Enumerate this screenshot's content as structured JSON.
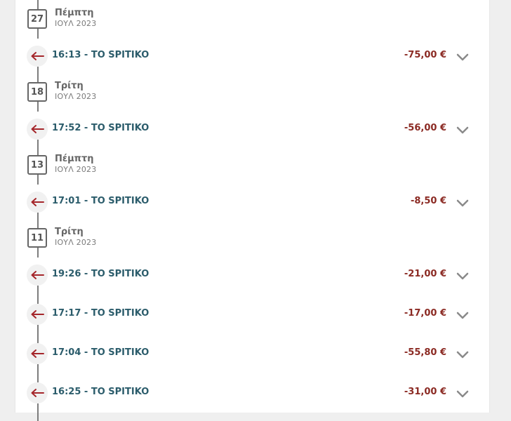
{
  "colors": {
    "accent_text": "#2b5c6b",
    "amount_negative": "#8b2a23",
    "arrow": "#a5262b"
  },
  "icons": {
    "transaction": "arrow-left-icon",
    "expand": "chevron-down-icon"
  },
  "groups": [
    {
      "day_num": "27",
      "day_name": "Πέμπτη",
      "month_year": "ΙΟΥΛ 2023",
      "transactions": [
        {
          "time_merchant": "16:13 - TO SPITIKO",
          "amount": "-75,00 €"
        }
      ]
    },
    {
      "day_num": "18",
      "day_name": "Τρίτη",
      "month_year": "ΙΟΥΛ 2023",
      "transactions": [
        {
          "time_merchant": "17:52 - TO SPITIKO",
          "amount": "-56,00 €"
        }
      ]
    },
    {
      "day_num": "13",
      "day_name": "Πέμπτη",
      "month_year": "ΙΟΥΛ 2023",
      "transactions": [
        {
          "time_merchant": "17:01 - TO SPITIKO",
          "amount": "-8,50 €"
        }
      ]
    },
    {
      "day_num": "11",
      "day_name": "Τρίτη",
      "month_year": "ΙΟΥΛ 2023",
      "transactions": [
        {
          "time_merchant": "19:26 - TO SPITIKO",
          "amount": "-21,00 €"
        },
        {
          "time_merchant": "17:17 - TO SPITIKO",
          "amount": "-17,00 €"
        },
        {
          "time_merchant": "17:04 - TO SPITIKO",
          "amount": "-55,80 €"
        },
        {
          "time_merchant": "16:25 - TO SPITIKO",
          "amount": "-31,00 €"
        }
      ]
    }
  ]
}
